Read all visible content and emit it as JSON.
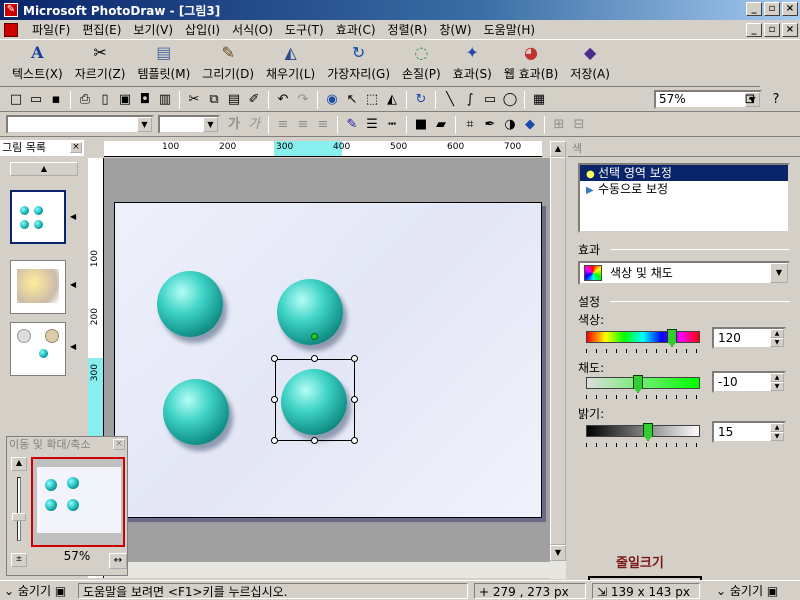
{
  "window": {
    "title": "Microsoft PhotoDraw - [그림3]",
    "minimize": "_",
    "restore": "▫",
    "close": "×"
  },
  "menu": [
    "파일(F)",
    "편집(E)",
    "보기(V)",
    "삽입(I)",
    "서식(O)",
    "도구(T)",
    "효과(C)",
    "정렬(R)",
    "창(W)",
    "도움말(H)"
  ],
  "visual_menu": [
    {
      "label": "텍스트(X)",
      "icon": "text-a-icon"
    },
    {
      "label": "자르기(Z)",
      "icon": "scissors-icon"
    },
    {
      "label": "템플릿(M)",
      "icon": "template-icon"
    },
    {
      "label": "그리기(D)",
      "icon": "brush-icon"
    },
    {
      "label": "채우기(L)",
      "icon": "paint-bucket-icon"
    },
    {
      "label": "가장자리(G)",
      "icon": "edge-icon"
    },
    {
      "label": "손질(P)",
      "icon": "touchup-icon"
    },
    {
      "label": "효과(S)",
      "icon": "effects-icon"
    },
    {
      "label": "웹 효과(B)",
      "icon": "web-effects-icon"
    },
    {
      "label": "저장(A)",
      "icon": "save-icon"
    }
  ],
  "toolbar": {
    "zoom": "57%"
  },
  "format_toolbar": {
    "bold": "가",
    "italic": "가"
  },
  "gallery": {
    "title": "그림 목록"
  },
  "ruler": {
    "h_labels": [
      "100",
      "200",
      "300",
      "400",
      "500",
      "600",
      "700"
    ],
    "v_labels": [
      "100",
      "200",
      "300"
    ]
  },
  "navigator": {
    "title": "이동 및 확대/축소",
    "zoom": "57%"
  },
  "right_panel": {
    "title": "색",
    "options": [
      "선택 영역 보정",
      "수동으로 보정"
    ],
    "effect_label": "효과",
    "effect_value": "색상 및 채도",
    "settings_label": "설정",
    "hue": {
      "label": "색상:",
      "value": "120",
      "level": 0.78
    },
    "saturation": {
      "label": "채도:",
      "value": "-10",
      "level": 0.45
    },
    "brightness": {
      "label": "밝기:",
      "value": "15",
      "level": 0.55
    }
  },
  "status": {
    "left_toggle": "숨기기",
    "help": "도움말을 보려면 <F1>키를 누르십시오.",
    "cursor": "279 , 273  px",
    "size": "139 x 143  px",
    "right_toggle": "숨기기"
  },
  "annotation": "줄일크기"
}
